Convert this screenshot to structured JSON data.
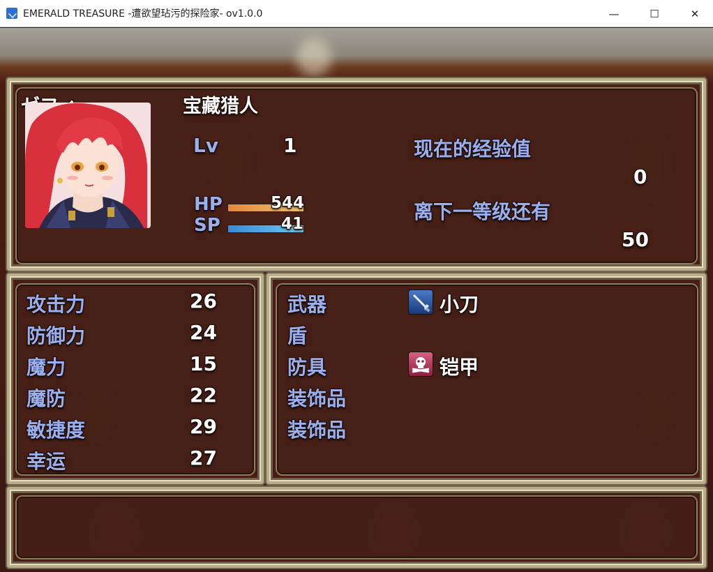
{
  "window": {
    "title": "EMERALD TREASURE -遭欲望玷污的探险家- ov1.0.0",
    "minimize_glyph": "—",
    "maximize_glyph": "☐",
    "close_glyph": "✕"
  },
  "actor": {
    "name": "ゼフィ",
    "class": "宝藏猎人",
    "level_label": "Lv",
    "level": "1",
    "hp_label": "HP",
    "hp": "544",
    "hp_ratio": 1.0,
    "sp_label": "SP",
    "sp": "41",
    "sp_ratio": 1.0,
    "exp_label": "现在的经验值",
    "exp": "0",
    "next_label": "离下一等级还有",
    "next": "50"
  },
  "params": [
    {
      "label": "攻击力",
      "value": "26"
    },
    {
      "label": "防御力",
      "value": "24"
    },
    {
      "label": "魔力",
      "value": "15"
    },
    {
      "label": "魔防",
      "value": "22"
    },
    {
      "label": "敏捷度",
      "value": "29"
    },
    {
      "label": "幸运",
      "value": "27"
    }
  ],
  "equips": [
    {
      "slot": "武器",
      "item": "小刀",
      "icon": "dagger-icon"
    },
    {
      "slot": "盾",
      "item": "",
      "icon": ""
    },
    {
      "slot": "防具",
      "item": "铠甲",
      "icon": "armor-icon"
    },
    {
      "slot": "装饰品",
      "item": "",
      "icon": ""
    },
    {
      "slot": "装饰品",
      "item": "",
      "icon": ""
    }
  ],
  "help_text": "",
  "colors": {
    "system_text": "#9ab0ee",
    "hp_gauge": [
      "#e08a3a",
      "#f0c070"
    ],
    "sp_gauge": [
      "#3a8ad8",
      "#70c8f0"
    ]
  }
}
